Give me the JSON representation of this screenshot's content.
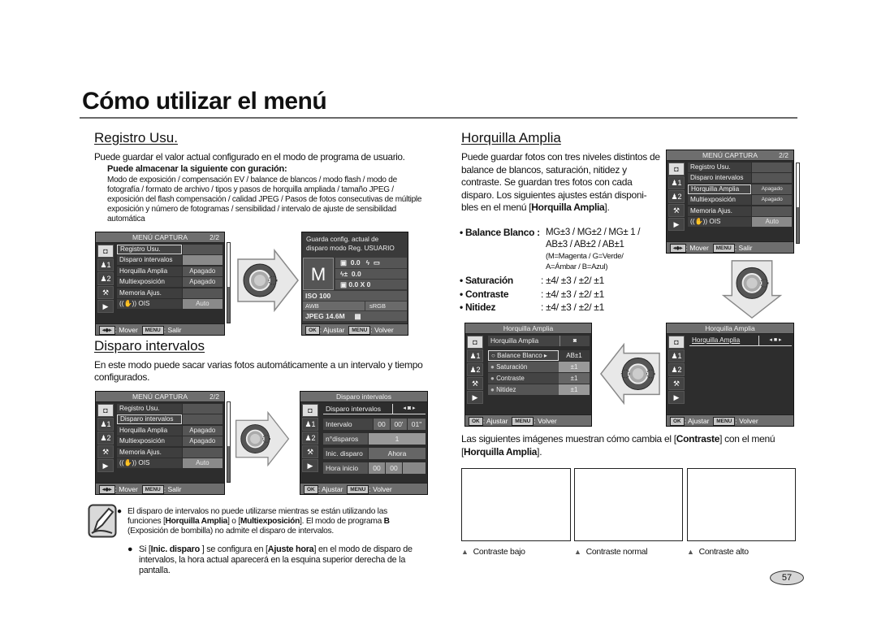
{
  "page": {
    "title": "Cómo utilizar el menú",
    "page_number": "57"
  },
  "registro": {
    "heading": "Registro Usu.",
    "intro": "Puede guardar el valor actual configurado en el modo de programa de usuario.",
    "sub_heading": "Puede almacenar la siguiente con  guración:",
    "detail": "Modo de exposición / compensación EV / balance de blancos / modo flash / modo de fotografía / formato de archivo / tipos y pasos de horquilla ampliada / tamaño JPEG / exposición del flash compensación / calidad JPEG / Pasos de fotos consecutivas de múltiple exposición y número de fotogramas / sensibilidad / intervalo de ajuste de sensibilidad automática"
  },
  "menu_captura": {
    "title": "MENÚ CAPTURA",
    "page": "2/2",
    "tabs": [
      "camera",
      "user1",
      "user2",
      "setup",
      "play"
    ],
    "tab_glyphs": [
      "◘",
      "♟1",
      "♟2",
      "⚒",
      "▶"
    ],
    "rows": [
      {
        "label": "Registro Usu.",
        "value": ""
      },
      {
        "label": "Disparo intervalos",
        "value": ""
      },
      {
        "label": "Horquilla Amplia",
        "value": "Apagado"
      },
      {
        "label": "Multiexposición",
        "value": "Apagado"
      },
      {
        "label": "Memoria Ajus.",
        "value": ""
      },
      {
        "label": "((✋)) OIS",
        "value": "Auto"
      }
    ],
    "footer_key1": "◂◆▸",
    "footer_move": ": Mover",
    "footer_key2": "MENU",
    "footer_exit": ": Salir"
  },
  "registro_confirm": {
    "message_line1": "Guarda config. actual de",
    "message_line2": "disparo modo Reg. USUARIO",
    "mode": "M",
    "ev": "0.0",
    "flash_ev": "0.0",
    "bracket": "0.0 X 0",
    "iso": "ISO  100",
    "wb": "AWB",
    "color_space": "sRGB",
    "jpeg": "JPEG  14.6M",
    "footer_key1": "OK",
    "footer_adjust": ": Ajustar",
    "footer_key2": "MENU",
    "footer_back": ": Volver"
  },
  "intervalos": {
    "heading": "Disparo intervalos",
    "intro": "En este modo puede sacar varias fotos automáticamente a un intervalo y tiempo configurados.",
    "screen": {
      "title": "Disparo intervalos",
      "header_label": "Disparo intervalos",
      "header_value": "◂ ◙ ▸",
      "rows": [
        {
          "label": "Intervalo",
          "values": [
            "00",
            "00'",
            "01\""
          ]
        },
        {
          "label": "n°disparos",
          "values": [
            "1"
          ]
        },
        {
          "label": "Inic. disparo",
          "values": [
            "Ahora"
          ]
        },
        {
          "label": "Hora inicio",
          "values": [
            "00",
            "00",
            ""
          ]
        }
      ]
    }
  },
  "note": {
    "bullet1_a": "El disparo de intervalos no puede utilizarse mientras se están utilizando las funciones [",
    "bullet1_b1": "Horquilla Amplia",
    "bullet1_c": "] o [",
    "bullet1_b2": "Multiexposición",
    "bullet1_d": "]. El modo de programa ",
    "bullet1_b3": "B",
    "bullet1_e": " (Exposición de bombilla) no admite el disparo de intervalos.",
    "bullet2_a": "Si [",
    "bullet2_b1": "Inic. disparo",
    "bullet2_c": " ] se configura en [",
    "bullet2_b2": "Ajuste hora",
    "bullet2_d": "] en el modo de disparo de intervalos, la hora actual aparecerá en la esquina superior derecha de la pantalla."
  },
  "horquilla": {
    "heading": "Horquilla Amplia",
    "intro_a": "Puede guardar fotos con tres niveles distintos de balance de blancos, saturación, nitidez y contraste. Se guardan tres fotos con cada disparo. Los siguientes ajustes están disponi-bles en el menú [",
    "intro_b": "Horquilla Amplia",
    "intro_c": "].",
    "settings": [
      {
        "name": "Balance Blanco",
        "values": "MG±3 / MG±2 / MG± 1 / AB±3 / AB±2 / AB±1",
        "note": "(M=Magenta / G=Verde/ A=Ámbar / B=Azul)"
      },
      {
        "name": "Saturación",
        "values": "±4/ ±3 / ±2/ ±1"
      },
      {
        "name": "Contraste",
        "values": "±4/ ±3 / ±2/ ±1"
      },
      {
        "name": "Nitidez",
        "values": "±4/ ±3 / ±2/ ±1"
      }
    ],
    "screen_detail": {
      "title": "Horquilla Amplia",
      "header_label": "Horquilla Amplia",
      "header_value": "◙",
      "rows": [
        {
          "label": "Balance Blanco ▸",
          "value": "AB±1"
        },
        {
          "label": "Saturación",
          "value": "±1"
        },
        {
          "label": "Contraste",
          "value": "±1"
        },
        {
          "label": "Nitidez",
          "value": "±1"
        }
      ]
    },
    "screen_off": {
      "title": "Horquilla Amplia",
      "header_label": "Horquilla Amplia",
      "header_value": "◂ ■ ▸"
    },
    "contrast_intro_a": "Las siguientes imágenes muestran cómo cambia el [",
    "contrast_intro_b": "Contraste",
    "contrast_intro_c": "] con el menú [",
    "contrast_intro_d": "Horquilla Amplia",
    "contrast_intro_e": "].",
    "captions": [
      "Contraste bajo",
      "Contraste normal",
      "Contraste alto"
    ],
    "caption_marker": "▲"
  }
}
